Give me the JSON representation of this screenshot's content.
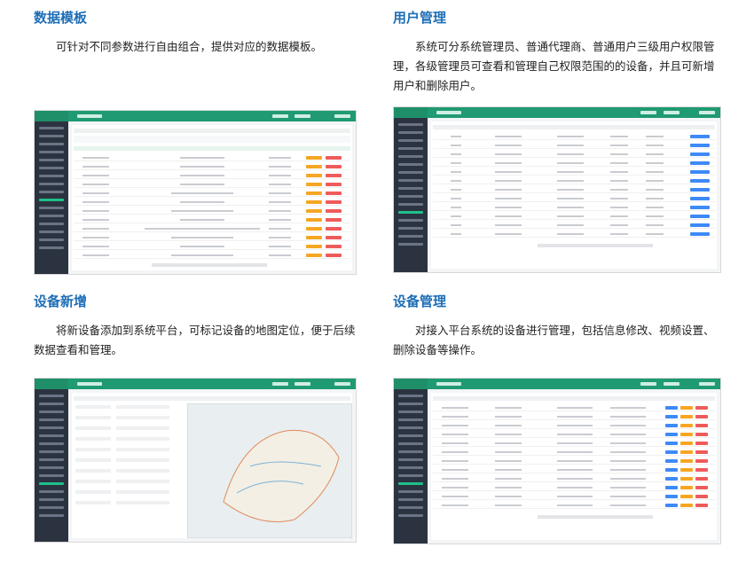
{
  "sections": [
    {
      "title": "数据模板",
      "desc": "可针对不同参数进行自由组合，提供对应的数据模板。"
    },
    {
      "title": "用户管理",
      "desc": "系统可分系统管理员、普通代理商、普通用户三级用户权限管理，各级管理员可查看和管理自己权限范围的的设备，并且可新增用户和删除用户。"
    },
    {
      "title": "设备新增",
      "desc": "将新设备添加到系统平台，可标记设备的地图定位，便于后续数据查看和管理。"
    },
    {
      "title": "设备管理",
      "desc": "对接入平台系统的设备进行管理，包括信息修改、视频设置、删除设备等操作。"
    }
  ],
  "colors": {
    "title": "#1e6eb6",
    "sidebar": "#2c3340",
    "topbar": "#1f9a72"
  }
}
